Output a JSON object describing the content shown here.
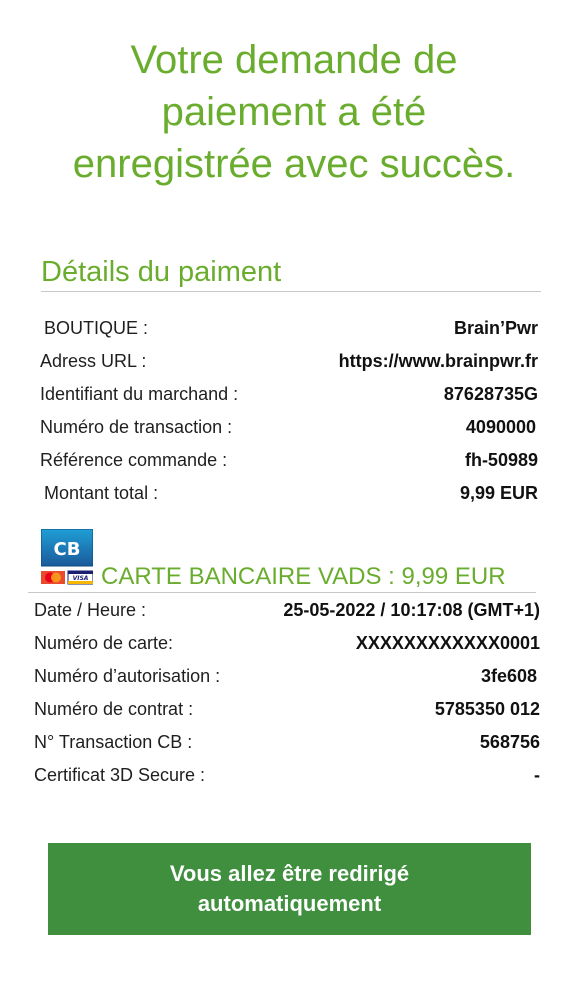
{
  "headline": {
    "line1": "Votre demande de",
    "line2": "paiement a été",
    "line3": "enregistrée avec succès."
  },
  "payment_details": {
    "title": "Détails du paiment",
    "rows": [
      {
        "label": "BOUTIQUE :",
        "value": "Brain’Pwr"
      },
      {
        "label": "Adress URL :",
        "value": "https://www.brainpwr.fr"
      },
      {
        "label": "Identifiant du marchand :",
        "value": "87628735G"
      },
      {
        "label": "Numéro de transaction :",
        "value": "4090000"
      },
      {
        "label": "Référence commande :",
        "value": "fh-50989"
      },
      {
        "label": "Montant total :",
        "value": "9,99 EUR"
      }
    ]
  },
  "card": {
    "logo_icon": "cb-mastercard-visa-logo-icon",
    "title": "CARTE BANCAIRE VADS : 9,99 EUR",
    "rows": [
      {
        "label": "Date / Heure :",
        "value": "25-05-2022 / 10:17:08 (GMT+1)"
      },
      {
        "label": "Numéro de carte:",
        "value": "XXXXXXXXXXXX0001"
      },
      {
        "label": "Numéro d’autorisation :",
        "value": "3fe608"
      },
      {
        "label": "Numéro de contrat :",
        "value": "5785350 012"
      },
      {
        "label": "N° Transaction CB :",
        "value": "568756"
      },
      {
        "label": "Certificat 3D Secure :",
        "value": "-"
      }
    ]
  },
  "redirect": {
    "line1": "Vous allez  être redirigé",
    "line2": "automatiquement"
  },
  "colors": {
    "accent_green": "#6aad2e",
    "button_green": "#3f8f3f"
  }
}
